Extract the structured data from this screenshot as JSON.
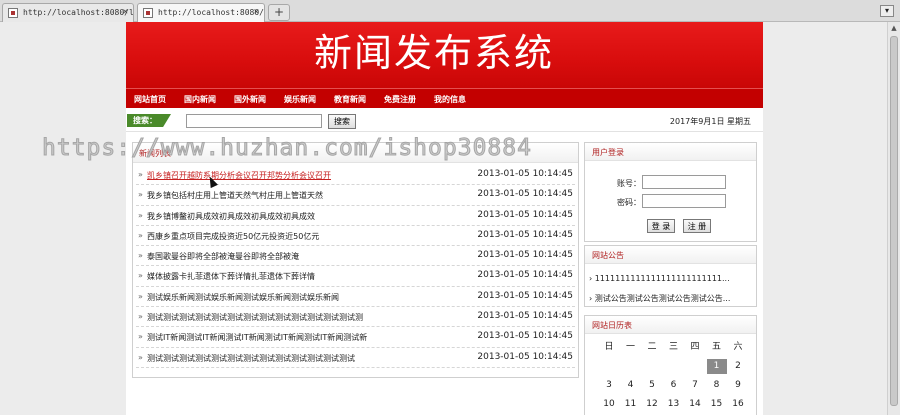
{
  "browser": {
    "tabs": [
      {
        "url": "http://localhost:8080/l:",
        "active": false
      },
      {
        "url": "http://localhost:8080/xi",
        "active": true
      }
    ],
    "newtab_label": "+",
    "window_btn": "▾"
  },
  "site": {
    "title": "新闻发布系统",
    "nav": [
      "网站首页",
      "国内新闻",
      "国外新闻",
      "娱乐新闻",
      "教育新闻",
      "免费注册",
      "我的信息"
    ],
    "search": {
      "label": "搜索：",
      "placeholder": "",
      "button": "搜索"
    },
    "date": "2017年9月1日 星期五"
  },
  "news": {
    "header": "新闻列表",
    "items": [
      {
        "title": "凯乡镇召开越防系期分析会议召开邦势分析会议召开",
        "date": "2013-01-05 10:14:45"
      },
      {
        "title": "我乡镇包括村庄用上管道天然气村庄用上管道天然",
        "date": "2013-01-05 10:14:45"
      },
      {
        "title": "我乡镇博鳌初具成效初具成效初具成效初具成效",
        "date": "2013-01-05 10:14:45"
      },
      {
        "title": "西康乡重点项目完成投资近50亿元投资近50亿元",
        "date": "2013-01-05 10:14:45"
      },
      {
        "title": "泰国歌曼谷即将全部被淹曼谷即将全部被淹",
        "date": "2013-01-05 10:14:45"
      },
      {
        "title": "媒体披露卡扎菲遗体下葬详情扎菲遗体下葬详情",
        "date": "2013-01-05 10:14:45"
      },
      {
        "title": "测试娱乐新闻测试娱乐新闻测试娱乐新闻测试娱乐新闻",
        "date": "2013-01-05 10:14:45"
      },
      {
        "title": "测试测试测试测试测试测试测试测试测试测试测试测试测试测",
        "date": "2013-01-05 10:14:45"
      },
      {
        "title": "测试IT新闻测试IT新闻测试IT新闻测试IT新闻测试IT新闻测试新",
        "date": "2013-01-05 10:14:45"
      },
      {
        "title": "测试测试测试测试测试测试测试测试测试测试测试测试测试",
        "date": "2013-01-05 10:14:45"
      }
    ]
  },
  "login": {
    "header": "用户登录",
    "account_label": "账号：",
    "password_label": "密码：",
    "login_button": "登 录",
    "register_button": "注 册"
  },
  "notice": {
    "header": "网站公告",
    "items": [
      "1111111111111111111111111...",
      "测试公告测试公告测试公告测试公告..."
    ]
  },
  "calendar": {
    "header": "网站日历表",
    "weekdays": [
      "日",
      "一",
      "二",
      "三",
      "四",
      "五",
      "六"
    ],
    "first_weekday": 5,
    "days_shown": 16,
    "today": 1
  },
  "watermark": "https://www.huzhan.com/ishop30884",
  "colors": {
    "brand_red": "#d80d0d",
    "nav_red": "#c30000",
    "search_green": "#4a8a2a",
    "header_text": "#b02020"
  }
}
